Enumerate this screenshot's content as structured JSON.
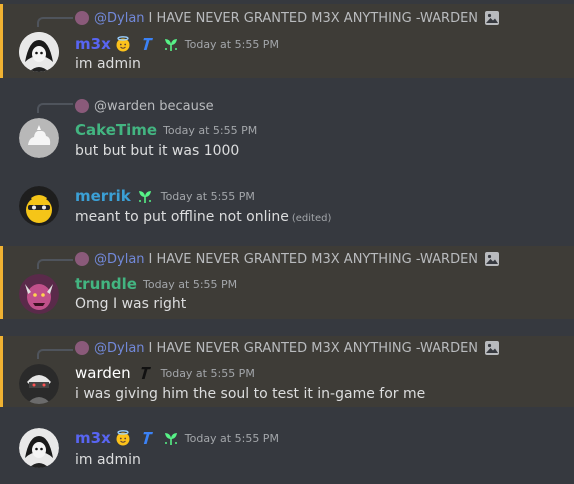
{
  "messages": [
    {
      "reply": {
        "prefix": "@",
        "name": "Dylan",
        "text": "I HAVE NEVER GRANTED M3X ANYTHING -WARDEN",
        "name_color": "#7289da"
      },
      "username": "m3x",
      "username_color": "#5865f2",
      "timestamp": "Today at 5:55 PM",
      "content": "im admin",
      "badges": [
        "halo-emoji-icon",
        "italic-t-icon",
        "sprout-icon"
      ]
    },
    {
      "reply": {
        "prefix": "@",
        "name": "warden",
        "text": "because",
        "name_color": "#b9bbbe"
      },
      "username": "CakeTime",
      "username_color": "#43b581",
      "timestamp": "Today at 5:55 PM",
      "content": "but but but it was 1000"
    },
    {
      "username": "merrik",
      "username_color": "#3ba0d6",
      "timestamp": "Today at 5:55 PM",
      "content": "meant to put offline not online",
      "edited": "(edited)",
      "badges": [
        "sprout-icon"
      ]
    },
    {
      "reply": {
        "prefix": "@",
        "name": "Dylan",
        "text": "I HAVE NEVER GRANTED M3X ANYTHING -WARDEN",
        "name_color": "#7289da"
      },
      "username": "trundle",
      "username_color": "#43b581",
      "timestamp": "Today at 5:55 PM",
      "content": "Omg I was right"
    },
    {
      "reply": {
        "prefix": "@",
        "name": "Dylan",
        "text": "I HAVE NEVER GRANTED M3X ANYTHING -WARDEN",
        "name_color": "#7289da"
      },
      "username": "warden",
      "username_color": "#ffffff",
      "timestamp": "Today at 5:55 PM",
      "content": "i was giving him the soul to test it in-game for me",
      "badges": [
        "italic-t-icon"
      ]
    },
    {
      "username": "m3x",
      "username_color": "#5865f2",
      "timestamp": "Today at 5:55 PM",
      "content": "im admin",
      "badges": [
        "halo-emoji-icon",
        "italic-t-icon",
        "sprout-icon"
      ]
    }
  ]
}
